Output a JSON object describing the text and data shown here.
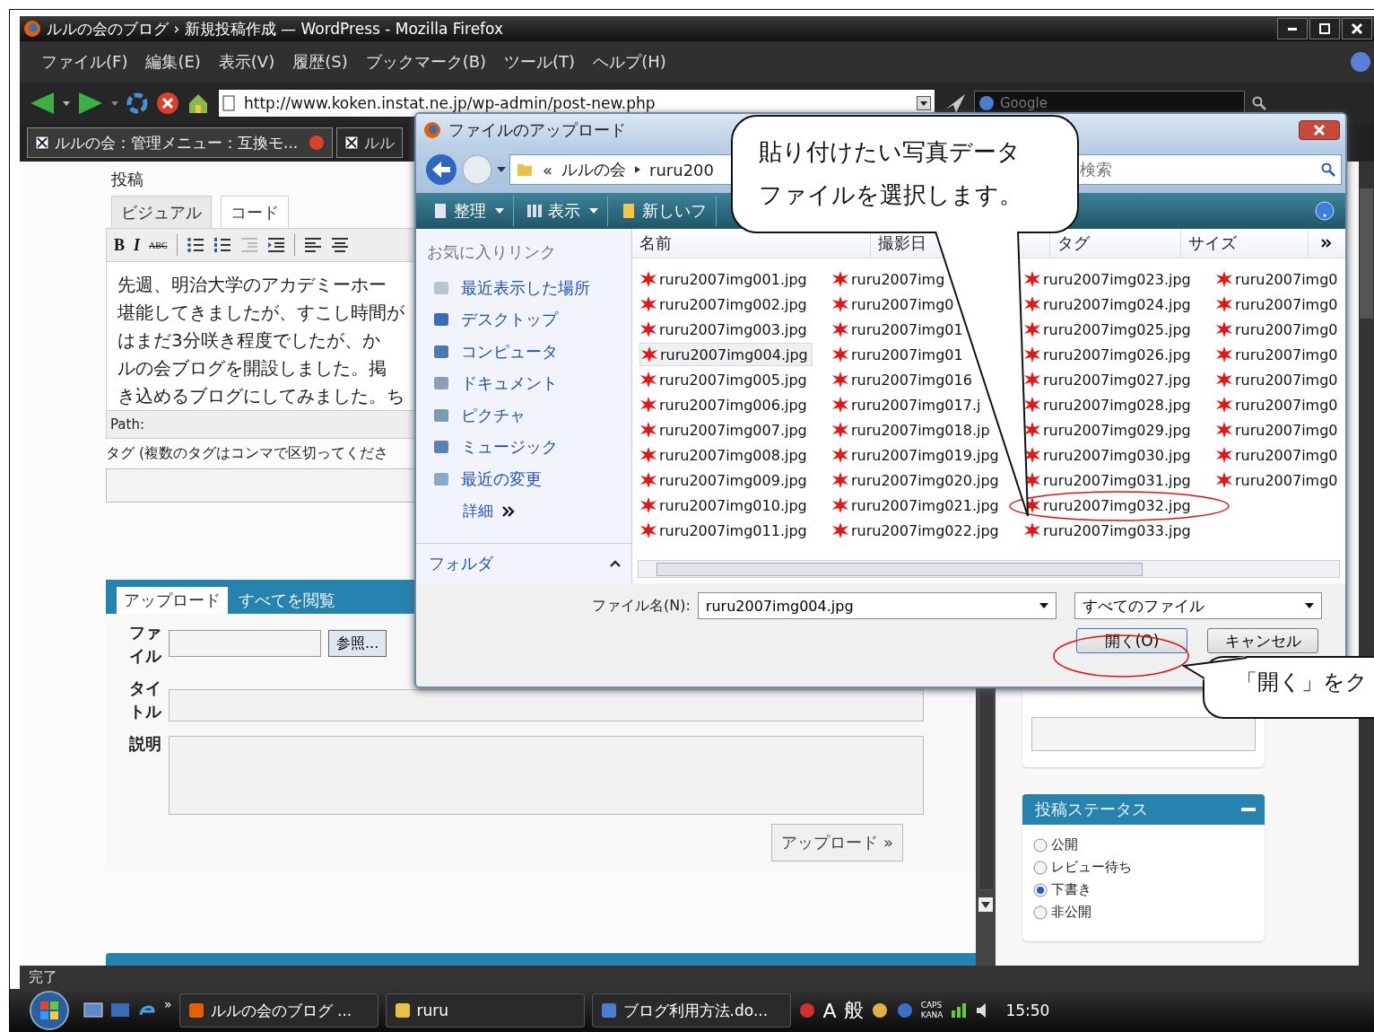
{
  "browser": {
    "title": "ルルの会のブログ › 新規投稿作成 — WordPress - Mozilla Firefox",
    "menu": [
      "ファイル(F)",
      "編集(E)",
      "表示(V)",
      "履歴(S)",
      "ブックマーク(B)",
      "ツール(T)",
      "ヘルプ(H)"
    ],
    "url": "http://www.koken.instat.ne.jp/wp-admin/post-new.php",
    "search_placeholder": "Google",
    "tabs": [
      {
        "label": "ルルの会：管理メニュー：互換モ...",
        "selected": true
      },
      {
        "label": "ルル",
        "selected": false
      }
    ],
    "status": "完了"
  },
  "editor": {
    "heading": "投稿",
    "modes": [
      {
        "label": "ビジュアル",
        "selected": true
      },
      {
        "label": "コード",
        "selected": false
      }
    ],
    "format_buttons": [
      {
        "label": "B",
        "kind": "bold"
      },
      {
        "label": "I",
        "kind": "italic"
      },
      {
        "label": "ABC",
        "kind": "spell"
      }
    ],
    "lines": [
      "先週、明治大学のアカデミーホー",
      "堪能してきましたが、すこし時間が",
      "はまだ3分咲き程度でしたが、か",
      "ルの会ブログを開設しました。掲",
      "き込めるブログにしてみました。ち"
    ],
    "path": "Path:",
    "tags_label": "タグ (複数のタグはコンマで区切ってくださ",
    "upload": {
      "tabs": [
        {
          "label": "アップロード",
          "selected": true
        },
        {
          "label": "すべてを閲覧",
          "selected": false
        }
      ],
      "fields": [
        {
          "label": "ファイル",
          "kind": "file",
          "button": "参照..."
        },
        {
          "label": "タイトル",
          "kind": "text"
        },
        {
          "label": "説明",
          "kind": "textarea"
        }
      ],
      "submit": "アップロード »"
    }
  },
  "sidebar": {
    "status_title": "投稿ステータス",
    "statuses": [
      {
        "label": "公開",
        "selected": false
      },
      {
        "label": "レビュー待ち",
        "selected": false
      },
      {
        "label": "下書き",
        "selected": true
      },
      {
        "label": "非公開",
        "selected": false
      }
    ]
  },
  "dialog": {
    "title": "ファイルのアップロード",
    "breadcrumb": [
      "«",
      "ルルの会",
      "ruru200"
    ],
    "search_placeholder": "検索",
    "toolbar": [
      {
        "label": "整理",
        "dropdown": true
      },
      {
        "label": "表示",
        "dropdown": true
      },
      {
        "label": "新しいフ",
        "dropdown": false
      }
    ],
    "favorites_title": "お気に入りリンク",
    "links": [
      "最近表示した場所",
      "デスクトップ",
      "コンピュータ",
      "ドキュメント",
      "ピクチャ",
      "ミュージック",
      "最近の変更"
    ],
    "more": "詳細",
    "folders": "フォルダ",
    "columns": [
      "名前",
      "撮影日",
      "タグ",
      "サイズ"
    ],
    "files": [
      {
        "name": "ruru2007img001.jpg",
        "selected": false
      },
      {
        "name": "ruru2007img002.jpg",
        "selected": false
      },
      {
        "name": "ruru2007img003.jpg",
        "selected": false
      },
      {
        "name": "ruru2007img004.jpg",
        "selected": true
      },
      {
        "name": "ruru2007img005.jpg",
        "selected": false
      },
      {
        "name": "ruru2007img006.jpg",
        "selected": false
      },
      {
        "name": "ruru2007img007.jpg",
        "selected": false
      },
      {
        "name": "ruru2007img008.jpg",
        "selected": false
      },
      {
        "name": "ruru2007img009.jpg",
        "selected": false
      },
      {
        "name": "ruru2007img010.jpg",
        "selected": false
      },
      {
        "name": "ruru2007img011.jpg",
        "selected": false
      },
      {
        "name": "ruru2007img",
        "selected": false
      },
      {
        "name": "ruru2007img0",
        "selected": false
      },
      {
        "name": "ruru2007img01",
        "selected": false
      },
      {
        "name": "ruru2007img01",
        "selected": false
      },
      {
        "name": "ruru2007img016",
        "selected": false
      },
      {
        "name": "ruru2007img017.j",
        "selected": false
      },
      {
        "name": "ruru2007img018.jp",
        "selected": false
      },
      {
        "name": "ruru2007img019.jpg",
        "selected": false
      },
      {
        "name": "ruru2007img020.jpg",
        "selected": false
      },
      {
        "name": "ruru2007img021.jpg",
        "selected": false
      },
      {
        "name": "ruru2007img022.jpg",
        "selected": false
      },
      {
        "name": "ruru2007img023.jpg",
        "selected": false
      },
      {
        "name": "ruru2007img024.jpg",
        "selected": false
      },
      {
        "name": "ruru2007img025.jpg",
        "selected": false
      },
      {
        "name": "ruru2007img026.jpg",
        "selected": false
      },
      {
        "name": "ruru2007img027.jpg",
        "selected": false
      },
      {
        "name": "ruru2007img028.jpg",
        "selected": false
      },
      {
        "name": "ruru2007img029.jpg",
        "selected": false
      },
      {
        "name": "ruru2007img030.jpg",
        "selected": false
      },
      {
        "name": "ruru2007img031.jpg",
        "selected": false
      },
      {
        "name": "ruru2007img032.jpg",
        "selected": false
      },
      {
        "name": "ruru2007img033.jpg",
        "selected": false
      },
      {
        "name": "ruru2007img0",
        "selected": false
      },
      {
        "name": "ruru2007img0",
        "selected": false
      },
      {
        "name": "ruru2007img0",
        "selected": false
      },
      {
        "name": "ruru2007img0",
        "selected": false
      },
      {
        "name": "ruru2007img0",
        "selected": false
      },
      {
        "name": "ruru2007img0",
        "selected": false
      },
      {
        "name": "ruru2007img0",
        "selected": false
      },
      {
        "name": "ruru2007img0",
        "selected": false
      },
      {
        "name": "ruru2007img0",
        "selected": false
      }
    ],
    "filename_label": "ファイル名(N):",
    "filename": "ruru2007img004.jpg",
    "filter": "すべてのファイル",
    "buttons": [
      "開く(O)",
      "キャンセル"
    ]
  },
  "callouts": [
    {
      "lines": [
        "貼り付けたい写真データ",
        "ファイルを選択します。"
      ]
    },
    {
      "lines": [
        "「開く」をク"
      ]
    }
  ],
  "taskbar": {
    "items": [
      "ルルの会のブログ ...",
      "ruru",
      "ブログ利用方法.do..."
    ],
    "more": "»",
    "ime": [
      "A",
      "般"
    ],
    "caps": "CAPS",
    "kana": "KANA",
    "time": "15:50"
  }
}
